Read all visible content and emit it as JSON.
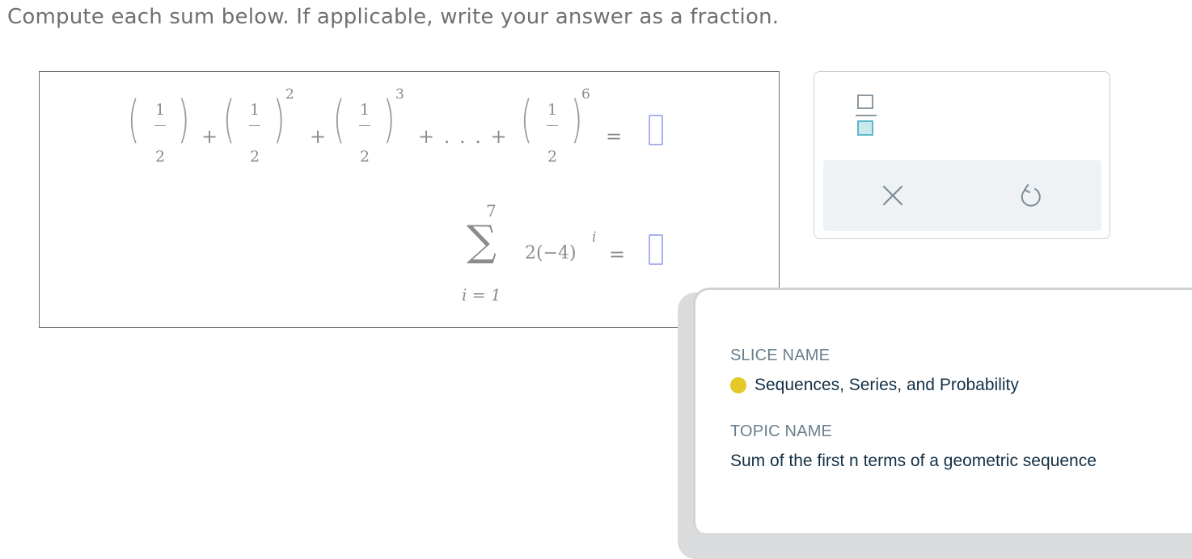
{
  "instruction": "Compute each sum below. If applicable, write your answer as a fraction.",
  "problem": {
    "part1": {
      "numerator": "1",
      "denominator": "2",
      "exponents": [
        "2",
        "3",
        "6"
      ],
      "plus": "+",
      "ellipsis": "+ . . . +",
      "equals": "="
    },
    "part2": {
      "upper_limit": "7",
      "lower_limit": "i = 1",
      "sigma": "∑",
      "term": "2(−4)",
      "exponent": "i",
      "equals": "="
    }
  },
  "keypad": {
    "fraction_icon": "fraction-icon",
    "clear_icon": "close-icon",
    "undo_icon": "undo-icon"
  },
  "info": {
    "slice_label": "SLICE NAME",
    "slice_value": "Sequences, Series, and Probability",
    "slice_color": "#e4c827",
    "topic_label": "TOPIC NAME",
    "topic_value": "Sum of the first n terms of a geometric sequence"
  }
}
